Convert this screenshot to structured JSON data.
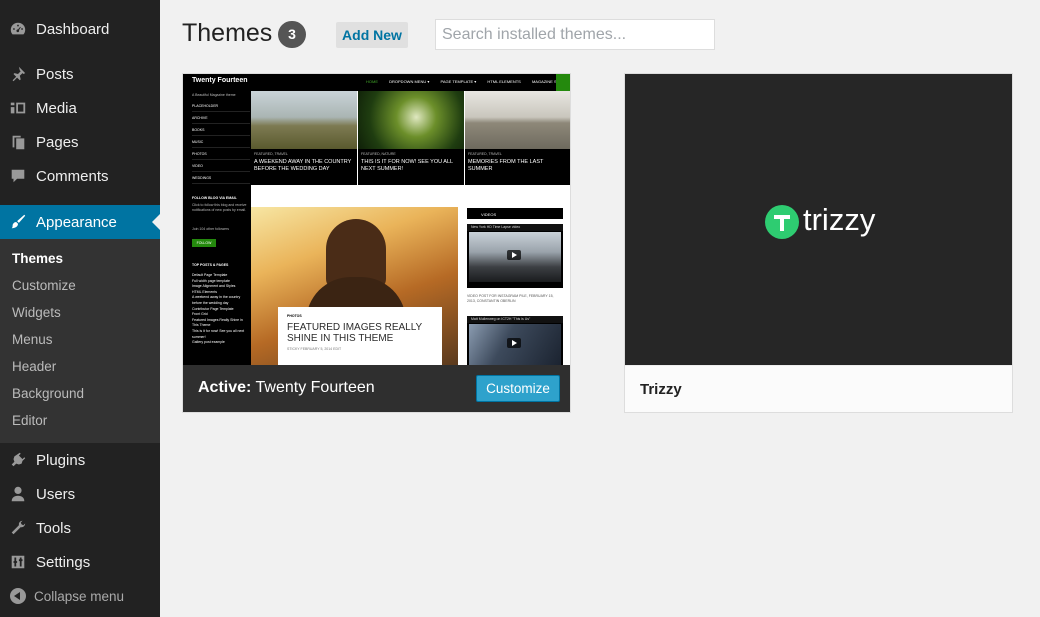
{
  "sidebar": {
    "items": [
      {
        "label": "Dashboard",
        "icon": "dashboard-icon"
      },
      {
        "label": "Posts",
        "icon": "pin-icon"
      },
      {
        "label": "Media",
        "icon": "media-icon"
      },
      {
        "label": "Pages",
        "icon": "pages-icon"
      },
      {
        "label": "Comments",
        "icon": "comment-icon"
      },
      {
        "label": "Appearance",
        "icon": "brush-icon"
      },
      {
        "label": "Plugins",
        "icon": "plug-icon"
      },
      {
        "label": "Users",
        "icon": "user-icon"
      },
      {
        "label": "Tools",
        "icon": "wrench-icon"
      },
      {
        "label": "Settings",
        "icon": "sliders-icon"
      }
    ],
    "submenu": [
      "Themes",
      "Customize",
      "Widgets",
      "Menus",
      "Header",
      "Background",
      "Editor"
    ],
    "collapse_label": "Collapse menu",
    "accent_color": "#0074a2"
  },
  "header": {
    "title": "Themes",
    "count": "3",
    "add_new_label": "Add New",
    "search_placeholder": "Search installed themes..."
  },
  "themes": {
    "active": {
      "prefix": "Active:",
      "name": "Twenty Fourteen",
      "customize_label": "Customize",
      "screenshot": {
        "brand": "Twenty Fourteen",
        "tagline": "A Beautiful Magazine theme",
        "nav": [
          "HOME",
          "DROPDOWN MENU ▾",
          "PAGE TEMPLATE ▾",
          "HTML ELEMENTS",
          "MAGAZINE STYLES"
        ],
        "left_menu": [
          "PLACEHOLDER",
          "ARCHIVE",
          "BOOKS",
          "MUSIC",
          "PHOTOS",
          "VIDEO",
          "WEDDINGS"
        ],
        "follow_title": "FOLLOW BLOG VIA EMAIL",
        "follow_text": "Click to follow this blog and receive notifications of new posts by email.",
        "follow_count": "Join 104 other followers",
        "follow_button": "FOLLOW",
        "recent_title": "TOP POSTS & PAGES",
        "recent_items": [
          "Default Page Template",
          "Full width page template",
          "Image Alignment and Styles",
          "HTML Elements",
          "A weekend away in the country before the wedding day",
          "Contributor Page Template",
          "Front Grid",
          "Featured Images Really Shine in This Theme",
          "This is it for now! See you all next summer!",
          "Gallery post example"
        ],
        "featured": [
          {
            "kicker": "FEATURED, TRAVEL",
            "title": "A WEEKEND AWAY IN THE COUNTRY BEFORE THE WEDDING DAY"
          },
          {
            "kicker": "FEATURED, NATURE",
            "title": "THIS IS IT FOR NOW! SEE YOU ALL NEXT SUMMER!"
          },
          {
            "kicker": "FEATURED, TRAVEL",
            "title": "MEMORIES FROM THE LAST SUMMER"
          }
        ],
        "post_kicker": "PHOTOS",
        "post_title": "FEATURED IMAGES REALLY SHINE IN THIS THEME",
        "post_meta": "STICKY   FEBRUARY 5, 2014   EDIT",
        "videos_title": "VIDEOS",
        "video1_title": "New York HD Time Lapse video",
        "video_meta": "VIDEO POST FOR INSTAGRAM PILE, FEBRUARY 15, 2013, CONSTANTIN OBERLIN",
        "video2_title": "Matt Mullenweg on ICT2H \"This is Us\""
      }
    },
    "other": {
      "name": "Trizzy",
      "logo_text": "trizzy",
      "logo_letter": "T",
      "logo_color": "#2ecc71"
    }
  }
}
